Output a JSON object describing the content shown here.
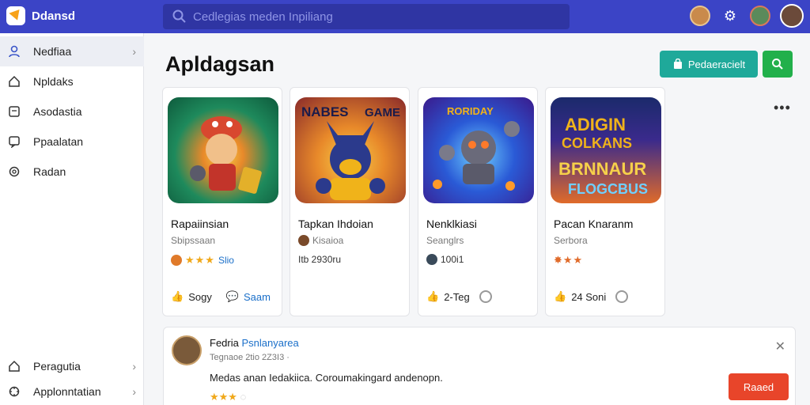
{
  "app": {
    "name": "Ddansd"
  },
  "search": {
    "placeholder": "Cedlegias meden Inpiliang"
  },
  "sidebar": {
    "items": [
      {
        "label": "Nedfiaa",
        "icon": "user-icon"
      },
      {
        "label": "Npldaks",
        "icon": "home-icon"
      },
      {
        "label": "Asodastia",
        "icon": "document-icon"
      },
      {
        "label": "Ppaalatan",
        "icon": "chat-icon"
      },
      {
        "label": "Radan",
        "icon": "gear-icon"
      }
    ],
    "bottom_items": [
      {
        "label": "Peragutia",
        "icon": "home-icon"
      },
      {
        "label": "Applonntatian",
        "icon": "settings-icon"
      }
    ]
  },
  "main": {
    "title": "Apldagsan",
    "primary_button": "Pedaeracielt"
  },
  "cards": [
    {
      "title": "Rapaiinsian",
      "subtitle": "Sbipssaan",
      "meta": "Slio",
      "foot_label": "Sogy",
      "foot_link": "Saam",
      "thumb_colors": [
        "#1e8a5c",
        "#d8482f"
      ]
    },
    {
      "title": "Tapkan Ihdoian",
      "subtitle": "Kisaioa",
      "meta": "Itb  2930ru",
      "foot_label": "",
      "foot_link": "",
      "thumb_colors": [
        "#f0b31a",
        "#2b3a8c"
      ],
      "thumb_text": "NABES GAME"
    },
    {
      "title": "Nenklkiasi",
      "subtitle": "Seanglrs",
      "meta": "100i1",
      "foot_label": "2-Teg",
      "foot_link": "",
      "thumb_colors": [
        "#2a5ad6",
        "#7b3cc8"
      ],
      "thumb_text": "RORIDAY"
    },
    {
      "title": "Pacan Knaranm",
      "subtitle": "Serbora",
      "meta": "",
      "foot_label": "24 Soni",
      "foot_link": "",
      "thumb_colors": [
        "#1b2a6b",
        "#e06b2a"
      ],
      "thumb_text": "ADIGIN COLKANS BRNNAUR FLOGCBUS"
    }
  ],
  "comment": {
    "name": "Fedria",
    "tag": "Psnlanyarea",
    "subline": "Tegnaoe  2tio  2Z3I3  ·",
    "body": "Medas anan Iedakiica. Coroumakingard andenopn.",
    "button": "Raaed"
  },
  "colors": {
    "topbar": "#3b44c6",
    "teal": "#1fa99a",
    "green": "#22b04b",
    "red": "#e8452a"
  }
}
